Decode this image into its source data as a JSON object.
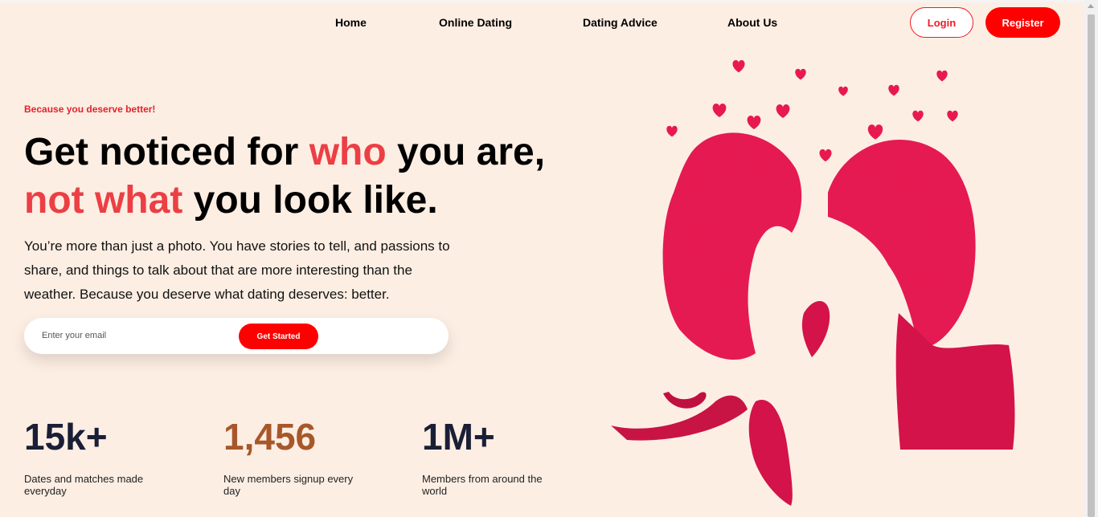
{
  "nav": {
    "links": [
      "Home",
      "Online Dating",
      "Dating Advice",
      "About Us"
    ],
    "login": "Login",
    "register": "Register"
  },
  "hero": {
    "eyebrow": "Because you deserve better!",
    "title_parts": [
      "Get noticed for ",
      "who",
      " you are, ",
      "not what",
      " you look like."
    ],
    "lead": "You’re more than just a photo. You have stories to tell, and passions to share, and things to talk about that are more interesting than the weather. Because you deserve what dating deserves: better.",
    "email_placeholder": "Enter your email",
    "cta": "Get Started"
  },
  "stats": [
    {
      "value": "15k+",
      "label": "Dates and matches made everyday"
    },
    {
      "value": "1,456",
      "label": "New members signup every day"
    },
    {
      "value": "1M+",
      "label": "Members from around the world"
    }
  ],
  "colors": {
    "accent": "#ff0000",
    "highlight": "#ec3f45",
    "background": "#fdeee3",
    "stat_mid": "#a7582a",
    "heart": "#e8194f"
  }
}
